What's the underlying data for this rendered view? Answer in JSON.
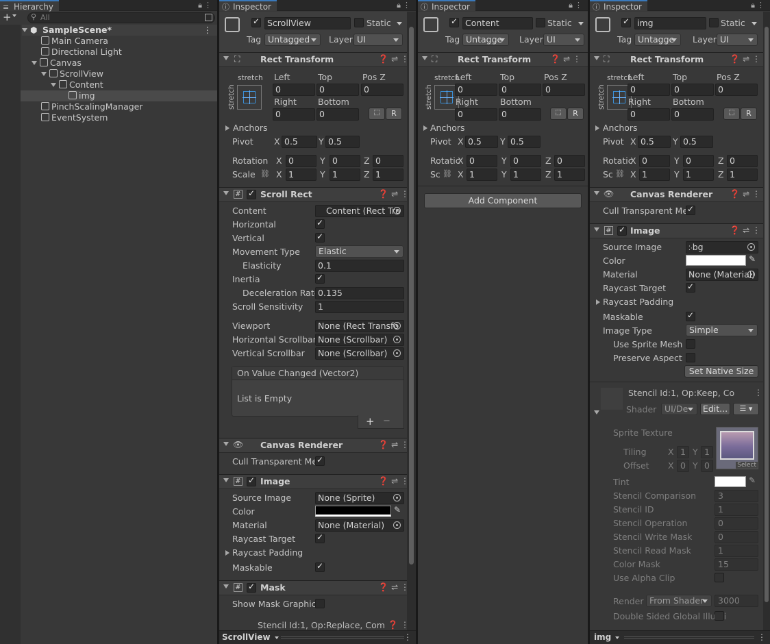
{
  "hierarchy": {
    "tab": "Hierarchy",
    "search_placeholder": "All",
    "scene": "SampleScene*",
    "items": [
      "Main Camera",
      "Directional Light",
      "Canvas",
      "ScrollView",
      "Content",
      "img",
      "PinchScalingManager",
      "EventSystem"
    ]
  },
  "inspector_common": {
    "tab": "Inspector",
    "static": "Static",
    "tag_label": "Tag",
    "layer_label": "Layer",
    "rect_transform": "Rect Transform",
    "stretch": "stretch",
    "left": "Left",
    "top": "Top",
    "posz": "Pos Z",
    "right": "Right",
    "bottom": "Bottom",
    "anchors": "Anchors",
    "pivot": "Pivot",
    "rotation": "Rotation",
    "scale": "Scale",
    "rot_short": "Rotatic",
    "scale_short": "Sc",
    "x": "X",
    "y": "Y",
    "z": "Z",
    "r": "R"
  },
  "inspector1": {
    "name": "ScrollView",
    "tag": "Untagged",
    "layer": "UI",
    "rt": {
      "left": "0",
      "top": "0",
      "posz": "0",
      "right": "0",
      "bottom": "0",
      "pivot_x": "0.5",
      "pivot_y": "0.5",
      "rot_x": "0",
      "rot_y": "0",
      "rot_z": "0",
      "sc_x": "1",
      "sc_y": "1",
      "sc_z": "1"
    },
    "scroll_rect": {
      "title": "Scroll Rect",
      "content_l": "Content",
      "content_v": "Content (Rect Tra",
      "horizontal": "Horizontal",
      "vertical": "Vertical",
      "movement_l": "Movement Type",
      "movement_v": "Elastic",
      "elasticity_l": "Elasticity",
      "elasticity_v": "0.1",
      "inertia_l": "Inertia",
      "decel_l": "Deceleration Rate",
      "decel_v": "0.135",
      "sens_l": "Scroll Sensitivity",
      "sens_v": "1",
      "viewport_l": "Viewport",
      "viewport_v": "None (Rect Transfo",
      "hscroll_l": "Horizontal Scrollbar",
      "hscroll_v": "None (Scrollbar)",
      "vscroll_l": "Vertical Scrollbar",
      "vscroll_v": "None (Scrollbar)",
      "event": "On Value Changed (Vector2)",
      "empty": "List is Empty",
      "plus": "+",
      "minus": "−"
    },
    "canvas_renderer": {
      "title": "Canvas Renderer",
      "cull": "Cull Transparent Mes"
    },
    "image": {
      "title": "Image",
      "source_l": "Source Image",
      "source_v": "None (Sprite)",
      "color_l": "Color",
      "material_l": "Material",
      "material_v": "None (Material)",
      "raycast_l": "Raycast Target",
      "padding_l": "Raycast Padding",
      "maskable_l": "Maskable"
    },
    "mask": {
      "title": "Mask",
      "show_l": "Show Mask Graphic"
    },
    "stencil": "Stencil Id:1, Op:Replace, Com",
    "footer": "ScrollView"
  },
  "inspector2": {
    "name": "Content",
    "tag": "Untagge",
    "layer": "UI",
    "rt": {
      "left": "0",
      "top": "0",
      "posz": "0",
      "right": "0",
      "bottom": "0",
      "pivot_x": "0.5",
      "pivot_y": "0.5",
      "rot_x": "0",
      "rot_y": "0",
      "rot_z": "0",
      "sc_x": "1",
      "sc_y": "1",
      "sc_z": "1"
    },
    "add_component": "Add Component"
  },
  "inspector3": {
    "name": "img",
    "tag": "Untagge",
    "layer": "UI",
    "rt": {
      "left": "0",
      "top": "0",
      "posz": "0",
      "right": "0",
      "bottom": "0",
      "pivot_x": "0.5",
      "pivot_y": "0.5",
      "rot_x": "0",
      "rot_y": "0",
      "rot_z": "0",
      "sc_x": "1",
      "sc_y": "1",
      "sc_z": "1"
    },
    "canvas_renderer": {
      "title": "Canvas Renderer",
      "cull": "Cull Transparent Mes"
    },
    "image": {
      "title": "Image",
      "source_l": "Source Image",
      "source_v": "bg",
      "color_l": "Color",
      "material_l": "Material",
      "material_v": "None (Material)",
      "raycast_l": "Raycast Target",
      "padding_l": "Raycast Padding",
      "maskable_l": "Maskable",
      "type_l": "Image Type",
      "type_v": "Simple",
      "sprite_mesh_l": "Use Sprite Mesh",
      "aspect_l": "Preserve Aspect",
      "native": "Set Native Size"
    },
    "material": {
      "stencil": "Stencil Id:1, Op:Keep, Co",
      "shader_l": "Shader",
      "shader_v": "UI/De",
      "edit": "Edit...",
      "sprite_tex": "Sprite Texture",
      "tiling": "Tiling",
      "offset": "Offset",
      "tile_x": "1",
      "tile_y": "1",
      "off_x": "0",
      "off_y": "0",
      "select": "Select",
      "tint": "Tint",
      "sc_l": "Stencil Comparison",
      "sc_v": "3",
      "sid_l": "Stencil ID",
      "sid_v": "1",
      "sop_l": "Stencil Operation",
      "sop_v": "0",
      "swm_l": "Stencil Write Mask",
      "swm_v": "0",
      "srm_l": "Stencil Read Mask",
      "srm_v": "1",
      "cm_l": "Color Mask",
      "cm_v": "15",
      "alpha_l": "Use Alpha Clip",
      "rq_l": "Render (",
      "rq_dd": "From Shader",
      "rq_v": "3000",
      "dsgi_l": "Double Sided Global Illumi"
    },
    "footer": "img"
  }
}
